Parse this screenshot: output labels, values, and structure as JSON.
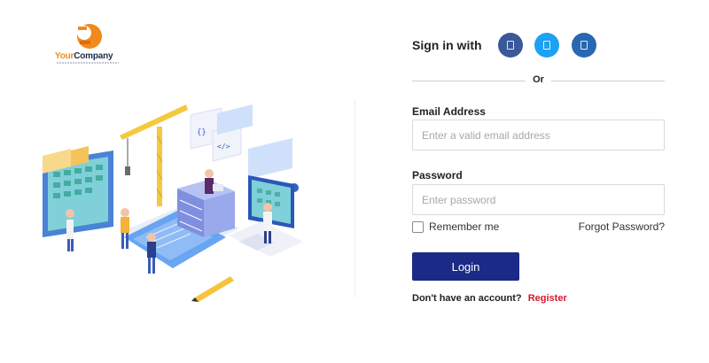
{
  "logo": {
    "brand_part1": "Your",
    "brand_part2": "Company"
  },
  "social": {
    "signin_label": "Sign in with",
    "buttons": [
      {
        "network": "facebook",
        "icon": "facebook-icon",
        "color": "#3b5998"
      },
      {
        "network": "twitter",
        "icon": "twitter-icon",
        "color": "#1da1f2"
      },
      {
        "network": "linkedin",
        "icon": "linkedin-icon",
        "color": "#2867b2"
      }
    ]
  },
  "divider": {
    "or_text": "Or"
  },
  "form": {
    "email_label": "Email Address",
    "email_placeholder": "Enter a valid email address",
    "email_value": "",
    "password_label": "Password",
    "password_placeholder": "Enter password",
    "password_value": "",
    "remember_label": "Remember me",
    "remember_checked": false,
    "forgot_label": "Forgot Password?",
    "login_label": "Login",
    "no_account_text": "Don't have an account?",
    "register_label": "Register"
  },
  "colors": {
    "primary_button": "#1b2a87",
    "register_link": "#d3192f",
    "brand_orange": "#f08a1c"
  }
}
